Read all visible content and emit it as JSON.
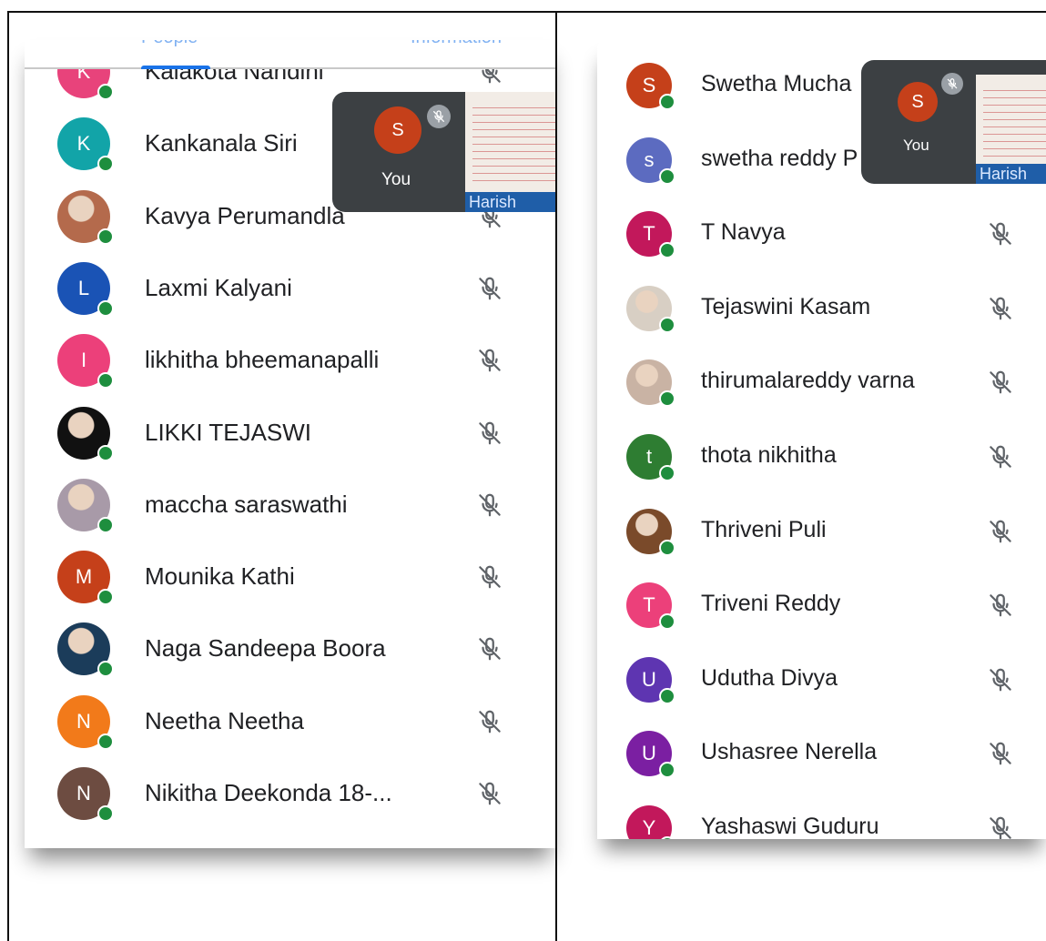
{
  "left_panel": {
    "tabs": [
      {
        "label": "People"
      },
      {
        "label": "Information"
      }
    ],
    "self_view": {
      "initial": "S",
      "label": "You",
      "thumbnail_name": "Harish"
    },
    "participants": [
      {
        "name": "Kalakota Nandini",
        "initial": "K",
        "color": "#e8437b",
        "mic": "muted"
      },
      {
        "name": "Kankanala Siri",
        "initial": "K",
        "color": "#12a4a8",
        "mic": "muted"
      },
      {
        "name": "Kavya Perumandla",
        "initial": "",
        "color": "#b46a4c",
        "photo": true,
        "mic": "muted"
      },
      {
        "name": "Laxmi Kalyani",
        "initial": "L",
        "color": "#1a53b5",
        "mic": "muted"
      },
      {
        "name": "likhitha bheemanapalli",
        "initial": "I",
        "color": "#ec407a",
        "mic": "muted"
      },
      {
        "name": "LIKKI TEJASWI",
        "initial": "",
        "color": "#111111",
        "photo": true,
        "mic": "muted"
      },
      {
        "name": "maccha saraswathi",
        "initial": "",
        "color": "#a89aa8",
        "photo": true,
        "mic": "muted"
      },
      {
        "name": "Mounika Kathi",
        "initial": "M",
        "color": "#c5401a",
        "mic": "muted"
      },
      {
        "name": "Naga Sandeepa Boora",
        "initial": "",
        "color": "#1b3c5a",
        "photo": true,
        "mic": "muted"
      },
      {
        "name": "Neetha Neetha",
        "initial": "N",
        "color": "#f27a1a",
        "mic": "muted"
      },
      {
        "name": "Nikitha Deekonda 18-...",
        "initial": "N",
        "color": "#6d4c41",
        "mic": "muted"
      }
    ]
  },
  "right_panel": {
    "self_view": {
      "initial": "S",
      "label": "You",
      "thumbnail_name": "Harish"
    },
    "participants": [
      {
        "name": "Swetha Mucha",
        "initial": "S",
        "color": "#c5401a",
        "mic": "muted"
      },
      {
        "name": "swetha reddy P",
        "initial": "s",
        "color": "#5c6bc0",
        "mic": "muted"
      },
      {
        "name": "T Navya",
        "initial": "T",
        "color": "#c2185b",
        "mic": "muted"
      },
      {
        "name": "Tejaswini Kasam",
        "initial": "",
        "color": "#d8cfc4",
        "photo": true,
        "mic": "muted"
      },
      {
        "name": "thirumalareddy varna",
        "initial": "",
        "color": "#c9b3a4",
        "photo": true,
        "mic": "muted"
      },
      {
        "name": "thota nikhitha",
        "initial": "t",
        "color": "#2e7d32",
        "mic": "muted"
      },
      {
        "name": "Thriveni Puli",
        "initial": "",
        "color": "#7a4a2a",
        "photo": true,
        "mic": "muted"
      },
      {
        "name": "Triveni Reddy",
        "initial": "T",
        "color": "#ec407a",
        "mic": "muted"
      },
      {
        "name": "Udutha Divya",
        "initial": "U",
        "color": "#5e35b1",
        "mic": "muted"
      },
      {
        "name": "Ushasree Nerella",
        "initial": "U",
        "color": "#7b1fa2",
        "mic": "muted"
      },
      {
        "name": "Yashaswi Guduru",
        "initial": "Y",
        "color": "#c2185b",
        "mic": "muted"
      }
    ]
  }
}
